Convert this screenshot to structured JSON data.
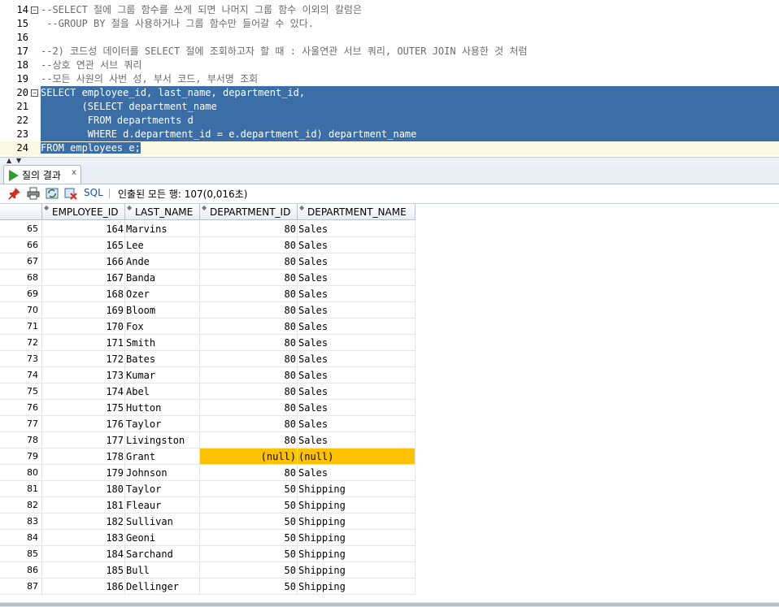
{
  "editor": {
    "lines": [
      {
        "n": "14",
        "fold": true,
        "style": "comment",
        "text": "--SELECT 절에 그룹 함수를 쓰게 되면 나머지 그룹 함수 이외의 칼럼은"
      },
      {
        "n": "15",
        "fold": false,
        "style": "comment",
        "text": " --GROUP BY 절을 사용하거나 그룹 함수만 들어갈 수 있다."
      },
      {
        "n": "16",
        "fold": false,
        "style": "plain",
        "text": ""
      },
      {
        "n": "17",
        "fold": false,
        "style": "comment",
        "text": "--2) 코드성 데이터를 SELECT 절에 조회하고자 할 때 : 사울연관 서브 쿼리, OUTER JOIN 사용한 것 처럼"
      },
      {
        "n": "18",
        "fold": false,
        "style": "comment",
        "text": "--상호 연관 서브 쿼리"
      },
      {
        "n": "19",
        "fold": false,
        "style": "comment",
        "text": "--모든 사원의 사번 성, 부서 코드, 부서명 조회"
      },
      {
        "n": "20",
        "fold": true,
        "style": "sel",
        "text": "SELECT employee_id, last_name, department_id,"
      },
      {
        "n": "21",
        "fold": false,
        "style": "sel",
        "text": "       (SELECT department_name"
      },
      {
        "n": "22",
        "fold": false,
        "style": "sel",
        "text": "        FROM departments d"
      },
      {
        "n": "23",
        "fold": false,
        "style": "sel",
        "text": "        WHERE d.department_id = e.department_id) department_name"
      },
      {
        "n": "24",
        "fold": false,
        "style": "partial",
        "text": "FROM employees e;"
      }
    ]
  },
  "results_tab": {
    "label": "질의 결과",
    "close": "x"
  },
  "toolbar": {
    "sql_label": "SQL",
    "separator": "|",
    "status": "인출된 모든 행: 107(0,016초)",
    "icons": [
      "pin-icon",
      "print-icon",
      "refresh-icon",
      "clear-icon"
    ]
  },
  "grid": {
    "columns": [
      "EMPLOYEE_ID",
      "LAST_NAME",
      "DEPARTMENT_ID",
      "DEPARTMENT_NAME"
    ],
    "highlight_color": "#fcc200",
    "rows": [
      {
        "r": "65",
        "id": "164",
        "name": "Marvins",
        "dept": "80",
        "dname": "Sales"
      },
      {
        "r": "66",
        "id": "165",
        "name": "Lee",
        "dept": "80",
        "dname": "Sales"
      },
      {
        "r": "67",
        "id": "166",
        "name": "Ande",
        "dept": "80",
        "dname": "Sales"
      },
      {
        "r": "68",
        "id": "167",
        "name": "Banda",
        "dept": "80",
        "dname": "Sales"
      },
      {
        "r": "69",
        "id": "168",
        "name": "Ozer",
        "dept": "80",
        "dname": "Sales"
      },
      {
        "r": "70",
        "id": "169",
        "name": "Bloom",
        "dept": "80",
        "dname": "Sales"
      },
      {
        "r": "71",
        "id": "170",
        "name": "Fox",
        "dept": "80",
        "dname": "Sales"
      },
      {
        "r": "72",
        "id": "171",
        "name": "Smith",
        "dept": "80",
        "dname": "Sales"
      },
      {
        "r": "73",
        "id": "172",
        "name": "Bates",
        "dept": "80",
        "dname": "Sales"
      },
      {
        "r": "74",
        "id": "173",
        "name": "Kumar",
        "dept": "80",
        "dname": "Sales"
      },
      {
        "r": "75",
        "id": "174",
        "name": "Abel",
        "dept": "80",
        "dname": "Sales"
      },
      {
        "r": "76",
        "id": "175",
        "name": "Hutton",
        "dept": "80",
        "dname": "Sales"
      },
      {
        "r": "77",
        "id": "176",
        "name": "Taylor",
        "dept": "80",
        "dname": "Sales"
      },
      {
        "r": "78",
        "id": "177",
        "name": "Livingston",
        "dept": "80",
        "dname": "Sales"
      },
      {
        "r": "79",
        "id": "178",
        "name": "Grant",
        "dept": "(null)",
        "dname": "(null)",
        "highlight": true
      },
      {
        "r": "80",
        "id": "179",
        "name": "Johnson",
        "dept": "80",
        "dname": "Sales"
      },
      {
        "r": "81",
        "id": "180",
        "name": "Taylor",
        "dept": "50",
        "dname": "Shipping"
      },
      {
        "r": "82",
        "id": "181",
        "name": "Fleaur",
        "dept": "50",
        "dname": "Shipping"
      },
      {
        "r": "83",
        "id": "182",
        "name": "Sullivan",
        "dept": "50",
        "dname": "Shipping"
      },
      {
        "r": "84",
        "id": "183",
        "name": "Geoni",
        "dept": "50",
        "dname": "Shipping"
      },
      {
        "r": "85",
        "id": "184",
        "name": "Sarchand",
        "dept": "50",
        "dname": "Shipping"
      },
      {
        "r": "86",
        "id": "185",
        "name": "Bull",
        "dept": "50",
        "dname": "Shipping"
      },
      {
        "r": "87",
        "id": "186",
        "name": "Dellinger",
        "dept": "50",
        "dname": "Shipping"
      }
    ]
  }
}
